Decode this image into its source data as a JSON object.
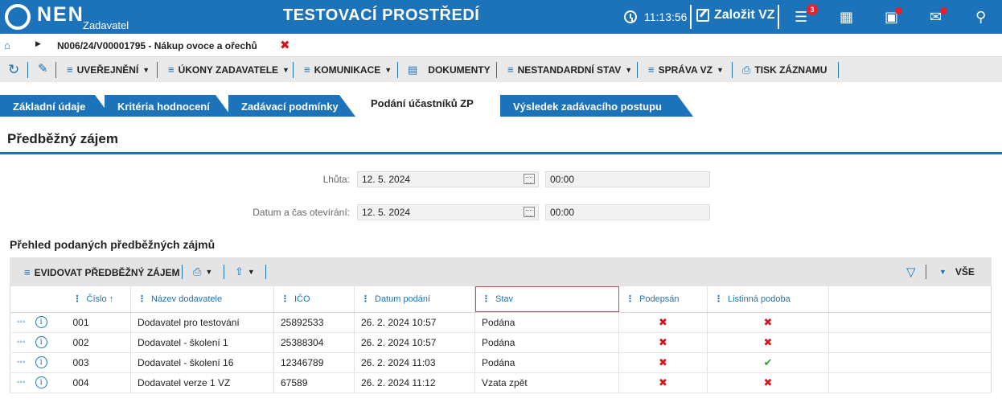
{
  "header": {
    "logo_text": "NEN",
    "logo_sub": "Zadavatel",
    "environment": "TESTOVACÍ PROSTŘEDÍ",
    "clock": "11:13:56",
    "create_label": "Založit VZ",
    "notification_count": "3"
  },
  "breadcrumb": {
    "path": "N006/24/V00001795 - Nákup ovoce a ořechů"
  },
  "toolbar": {
    "items": [
      {
        "label": "UVEŘEJNĚNÍ"
      },
      {
        "label": "ÚKONY ZADAVATELE"
      },
      {
        "label": "KOMUNIKACE"
      },
      {
        "label": "DOKUMENTY"
      },
      {
        "label": "NESTANDARDNÍ STAV"
      },
      {
        "label": "SPRÁVA VZ"
      },
      {
        "label": "TISK ZÁZNAMU"
      }
    ]
  },
  "tabs": [
    {
      "label": "Základní údaje",
      "active": false
    },
    {
      "label": "Kritéria hodnocení",
      "active": false
    },
    {
      "label": "Zadávací podmínky",
      "active": false
    },
    {
      "label": "Podání účastníků ZP",
      "active": true
    },
    {
      "label": "Výsledek zadávacího postupu",
      "active": false
    }
  ],
  "section": {
    "title": "Předběžný zájem"
  },
  "form": {
    "deadline_label": "Lhůta:",
    "deadline_date": "12. 5. 2024",
    "deadline_time": "00:00",
    "opening_label": "Datum a čas otevírání:",
    "opening_date": "12. 5. 2024",
    "opening_time": "00:00"
  },
  "grid": {
    "title": "Přehled podaných předběžných zájmů",
    "register_label": "EVIDOVAT PŘEDBĚŽNÝ ZÁJEM",
    "filter_label": "VŠE",
    "columns": [
      "Číslo",
      "Název dodavatele",
      "IČO",
      "Datum podání",
      "Stav",
      "Podepsán",
      "Listinná podoba"
    ],
    "rows": [
      {
        "cislo": "001",
        "nazev": "Dodavatel pro testování",
        "ico": "25892533",
        "datum": "26. 2. 2024 10:57",
        "stav": "Podána",
        "podepsan": false,
        "listinna": false
      },
      {
        "cislo": "002",
        "nazev": "Dodavatel - školení 1",
        "ico": "25388304",
        "datum": "26. 2. 2024 10:57",
        "stav": "Podána",
        "podepsan": false,
        "listinna": false
      },
      {
        "cislo": "003",
        "nazev": "Dodavatel - školení 16",
        "ico": "12346789",
        "datum": "26. 2. 2024 11:03",
        "stav": "Podána",
        "podepsan": false,
        "listinna": true
      },
      {
        "cislo": "004",
        "nazev": "Dodavatel verze 1 VZ",
        "ico": "67589",
        "datum": "26. 2. 2024 11:12",
        "stav": "Vzata zpět",
        "podepsan": false,
        "listinna": false
      }
    ]
  },
  "colors": {
    "brand": "#1c73ba",
    "alert": "#d6141c",
    "ok": "#3a9a3a"
  }
}
